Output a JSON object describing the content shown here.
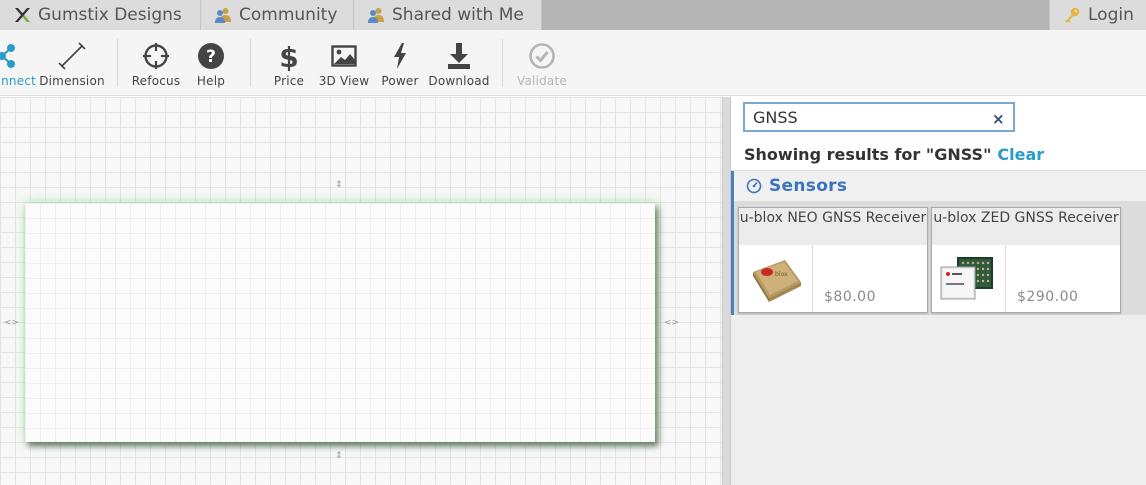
{
  "tabs": [
    {
      "label": "Gumstix Designs",
      "icon": "gumstix-x-logo-icon"
    },
    {
      "label": "Community",
      "icon": "users-icon"
    },
    {
      "label": "Shared with Me",
      "icon": "users-icon"
    }
  ],
  "login": {
    "label": "Login",
    "icon": "key-icon"
  },
  "toolbar": {
    "connect": "nnect",
    "dimension": "Dimension",
    "refocus": "Refocus",
    "help": "Help",
    "price": "Price",
    "view3d": "3D View",
    "power": "Power",
    "download": "Download",
    "validate": "Validate"
  },
  "canvas": {
    "handle_vertical": "⇕",
    "handle_horizontal": "<>"
  },
  "search": {
    "value": "GNSS",
    "clear_icon": "×",
    "results_text": "Showing results for \"GNSS\"",
    "clear_label": "Clear"
  },
  "category": {
    "title": "Sensors",
    "icon": "gauge-icon",
    "items": [
      {
        "name": "u-blox NEO GNSS Receiver",
        "price": "$80.00"
      },
      {
        "name": "u-blox ZED GNSS Receiver",
        "price": "$290.00"
      }
    ]
  },
  "colors": {
    "accent": "#3a73c0",
    "link": "#2a9bc7",
    "tab_bar": "#b5b5b5",
    "tab_bg": "#dcdcdc"
  }
}
